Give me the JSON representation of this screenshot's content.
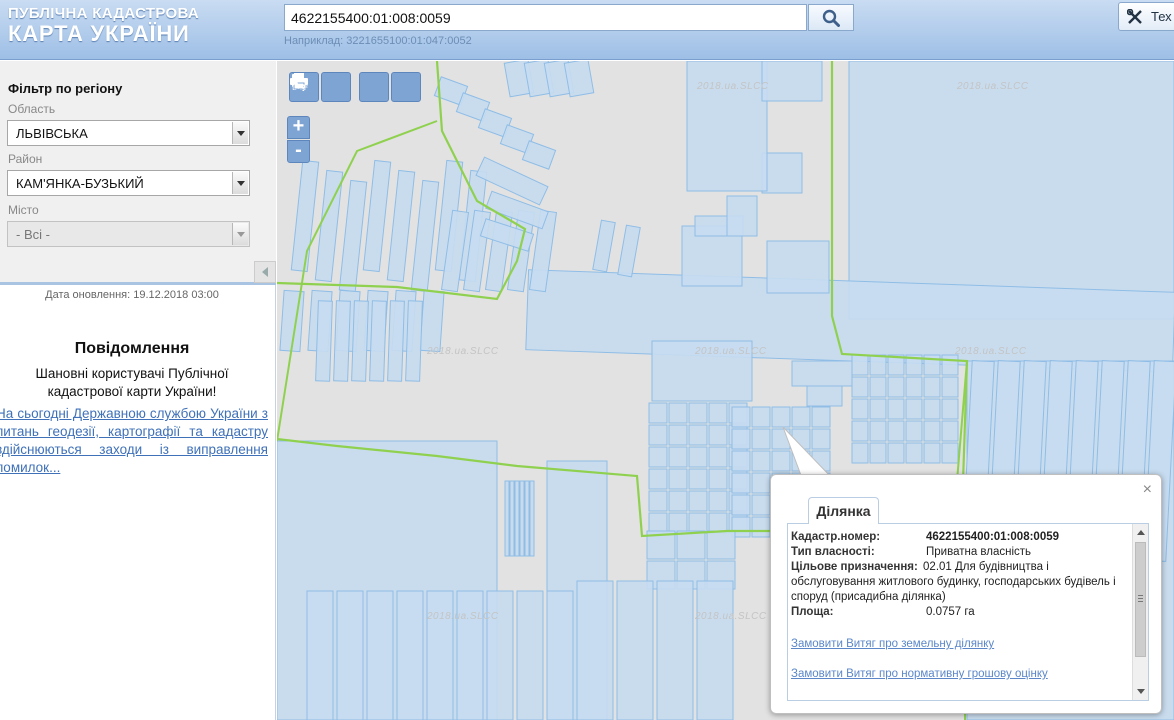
{
  "header": {
    "logo_line1": "ПУБЛІЧНА КАДАСТРОВА",
    "logo_line2": "КАРТА УКРАЇНИ",
    "search_value": "4622155400:01:008:0059",
    "search_hint": "Наприклад: 3221655100:01:047:0052",
    "search_icon": "search-icon",
    "tools_label": "Тех"
  },
  "filter": {
    "title": "Фільтр по регіону",
    "oblast_label": "Область",
    "oblast_value": "ЛЬВІВСЬКА",
    "rayon_label": "Район",
    "rayon_value": "КАМ'ЯНКА-БУЗЬКИЙ",
    "city_label": "Місто",
    "city_value": "- Всі -"
  },
  "sidebar": {
    "update_date": "Дата оновлення: 19.12.2018 03:00",
    "notice_title": "Повідомлення",
    "notice_text": "Шановні користувачі Публічної кадастрової карти України!",
    "notice_link": "На сьогодні Державною службою України з питань геодезії, картографії та кадастру здійснюються заходи із виправлення помилок..."
  },
  "map": {
    "zoom_in": "+",
    "zoom_out": "-",
    "watermark": "2018.ua.SLCC",
    "colors": {
      "parcel_fill": "#c7dcf0",
      "parcel_stroke": "#8fbde6",
      "boundary": "#8fd14f",
      "background": "#e2e2e2"
    }
  },
  "popup": {
    "tab_label": "Ділянка",
    "close": "×",
    "cadastral_key": "Кадастр.номер:",
    "cadastral_value": "4622155400:01:008:0059",
    "ownership_key": "Тип власності:",
    "ownership_value": "Приватна власність",
    "purpose_key": "Цільове призначення:",
    "purpose_value": "02.01 Для будівництва і обслуговування житлового будинку, господарських будівель і споруд (присадибна ділянка)",
    "area_key": "Площа:",
    "area_value": "0.0757 га",
    "link1": "Замовити Витяг про земельну ділянку",
    "link2": "Замовити Витяг про нормативну грошову оцінку"
  }
}
